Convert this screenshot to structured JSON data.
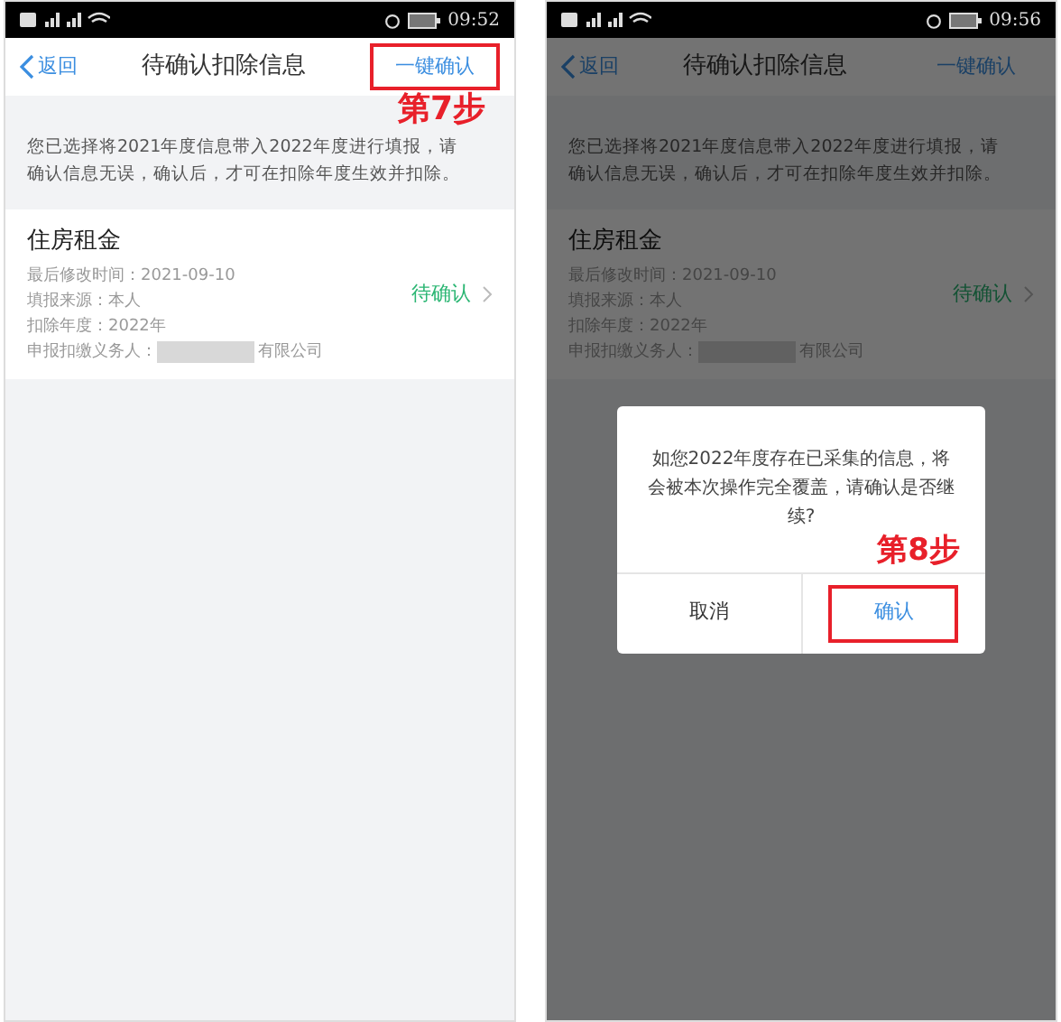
{
  "screens": [
    {
      "status_bar": {
        "time": "09:52"
      },
      "nav": {
        "back": "返回",
        "title": "待确认扣除信息",
        "action": "一键确认",
        "action_highlighted": true,
        "step_label": "第7步"
      },
      "notice": "您已选择将2021年度信息带入2022年度进行填报，请确认信息无误，确认后，才可在扣除年度生效并扣除。",
      "items": [
        {
          "title": "住房租金",
          "lines": [
            "最后修改时间：2021-09-10",
            "填报来源：本人",
            "扣除年度：2022年"
          ],
          "withholder_label": "申报扣缴义务人：",
          "withholder_suffix": "有限公司",
          "status": "待确认"
        }
      ]
    },
    {
      "status_bar": {
        "time": "09:56"
      },
      "nav": {
        "back": "返回",
        "title": "待确认扣除信息",
        "action": "一键确认",
        "action_highlighted": false
      },
      "notice": "您已选择将2021年度信息带入2022年度进行填报，请确认信息无误，确认后，才可在扣除年度生效并扣除。",
      "items": [
        {
          "title": "住房租金",
          "lines": [
            "最后修改时间：2021-09-10",
            "填报来源：本人",
            "扣除年度：2022年"
          ],
          "withholder_label": "申报扣缴义务人：",
          "withholder_suffix": "有限公司",
          "status": "待确认"
        }
      ],
      "dialog": {
        "message": "如您2022年度存在已采集的信息，将会被本次操作完全覆盖，请确认是否继续?",
        "step_label": "第8步",
        "buttons": [
          {
            "label": "取消",
            "highlighted": false
          },
          {
            "label": "确认",
            "highlighted": true
          }
        ]
      }
    }
  ]
}
